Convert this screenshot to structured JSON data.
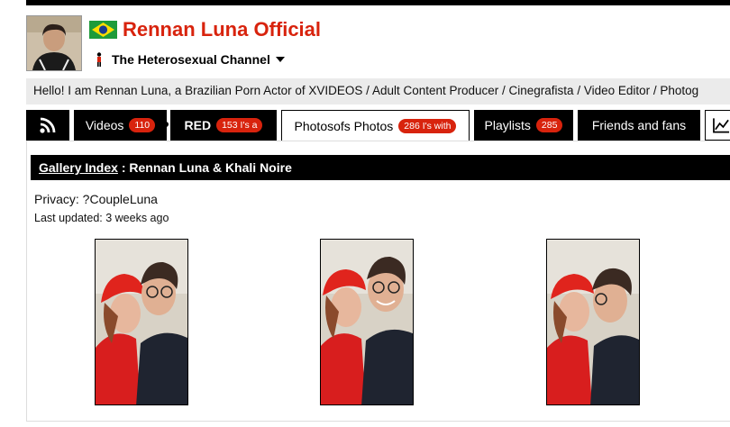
{
  "profile": {
    "name": "Rennan Luna Official",
    "channel": "The Heterosexual Channel",
    "bio": "Hello! I am Rennan Luna, a Brazilian Porn Actor of XVIDEOS / Adult Content Producer / Cinegrafista / Video Editor / Photog"
  },
  "tabs": [
    {
      "label": "Videos",
      "badge": "110"
    },
    {
      "label": "RED",
      "badge": "153 I's a"
    },
    {
      "label": "Photosofs Photos",
      "badge": "286 I's with"
    },
    {
      "label": "Playlists",
      "badge": "285"
    },
    {
      "label": "Friends and fans"
    }
  ],
  "gallery": {
    "index_link": "Gallery Index",
    "separator": " : ",
    "title": "Rennan Luna & Khali Noire",
    "privacy": "Privacy: ?CoupleLuna",
    "updated": "Last updated: 3 weeks ago"
  },
  "colors": {
    "accent": "#d8230d",
    "dark": "#000000",
    "bio_bg": "#ebebeb"
  },
  "icons": [
    "rss-icon",
    "chart-icon",
    "brazil-flag-icon",
    "person-icon",
    "chevron-down-icon"
  ]
}
